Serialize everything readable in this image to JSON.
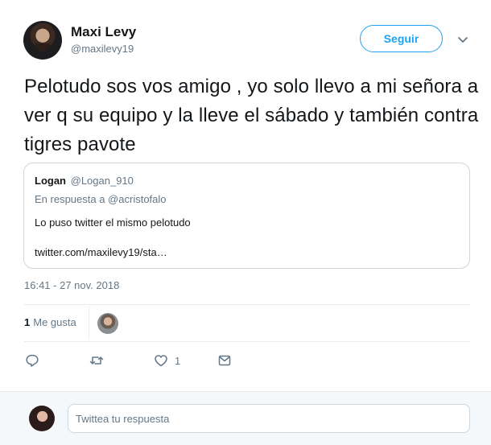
{
  "author": {
    "display_name": "Maxi Levy",
    "handle": "@maxilevy19"
  },
  "header": {
    "follow_label": "Seguir"
  },
  "tweet": {
    "text": "Pelotudo sos vos amigo  , yo solo llevo a mi señora a ver q su equipo y la lleve el sábado y también contra tigres pavote",
    "timestamp": "16:41 - 27 nov. 2018"
  },
  "quote": {
    "name": "Logan",
    "handle": "@Logan_910",
    "reply_to": "En respuesta a @acristofalo",
    "body": "Lo puso twitter el mismo pelotudo",
    "link": "twitter.com/maxilevy19/sta…"
  },
  "engagement": {
    "likes_count": "1",
    "likes_label": "Me gusta"
  },
  "actions": {
    "like_count": "1"
  },
  "reply": {
    "placeholder": "Twittea tu respuesta"
  },
  "colors": {
    "accent": "#1da1f2",
    "muted": "#657786",
    "border": "#e6ecf0"
  },
  "icons": [
    "reply-icon",
    "retweet-icon",
    "heart-icon",
    "direct-message-icon",
    "chevron-down-icon"
  ]
}
